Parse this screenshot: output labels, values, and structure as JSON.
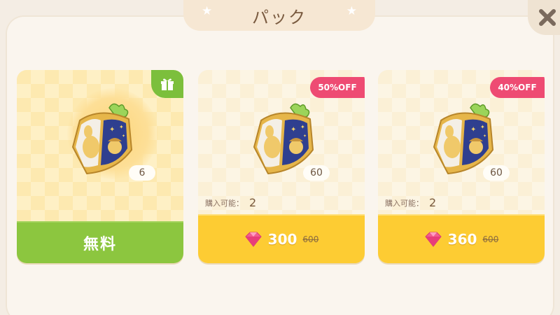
{
  "header": {
    "title": "パック"
  },
  "colors": {
    "accent_green": "#8cc63f",
    "accent_yellow": "#fdcc33",
    "discount_pink": "#ee4b73"
  },
  "packs": [
    {
      "quantity": "6",
      "button_label": "無料",
      "icon": "gift-icon"
    },
    {
      "quantity": "60",
      "discount": "50%OFF",
      "limit_label": "購入可能：",
      "limit_value": "2",
      "price": "300",
      "original_price": "600",
      "currency_icon": "pink-gem-icon"
    },
    {
      "quantity": "60",
      "discount": "40%OFF",
      "limit_label": "購入可能：",
      "limit_value": "2",
      "price": "360",
      "original_price": "600",
      "currency_icon": "pink-gem-icon"
    }
  ]
}
